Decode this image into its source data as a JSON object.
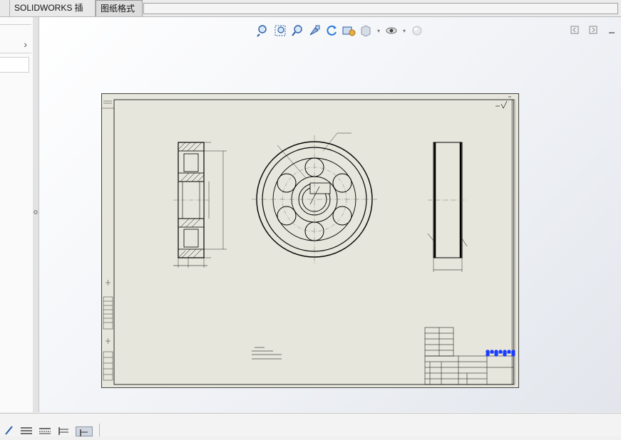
{
  "tabs": {
    "addins_label": "SOLIDWORKS 插件",
    "sheet_format_label": "图纸格式"
  },
  "left_panel": {
    "expand_glyph": "›"
  },
  "hud_icons": [
    "zoom-to-fit-icon",
    "zoom-to-area-icon",
    "zoom-in-out-icon",
    "pan-icon",
    "rotate-icon",
    "view-orientation-icon",
    "display-style-icon",
    "hide-show-items-icon",
    "edit-appearance-icon",
    "apply-scene-icon"
  ],
  "window_controls": [
    "restore-pane-icon",
    "next-pane-icon",
    "minimize-icon"
  ],
  "drawing": {
    "sheet_color": "#e6e6dc",
    "line_color": "#000000",
    "center_line_color": "#555555",
    "selection_color": "#1a3cff"
  },
  "status_icons": [
    "sketch-pencil-icon",
    "align-left-icon",
    "align-justify-icon",
    "table-icon",
    "layer-icon"
  ]
}
